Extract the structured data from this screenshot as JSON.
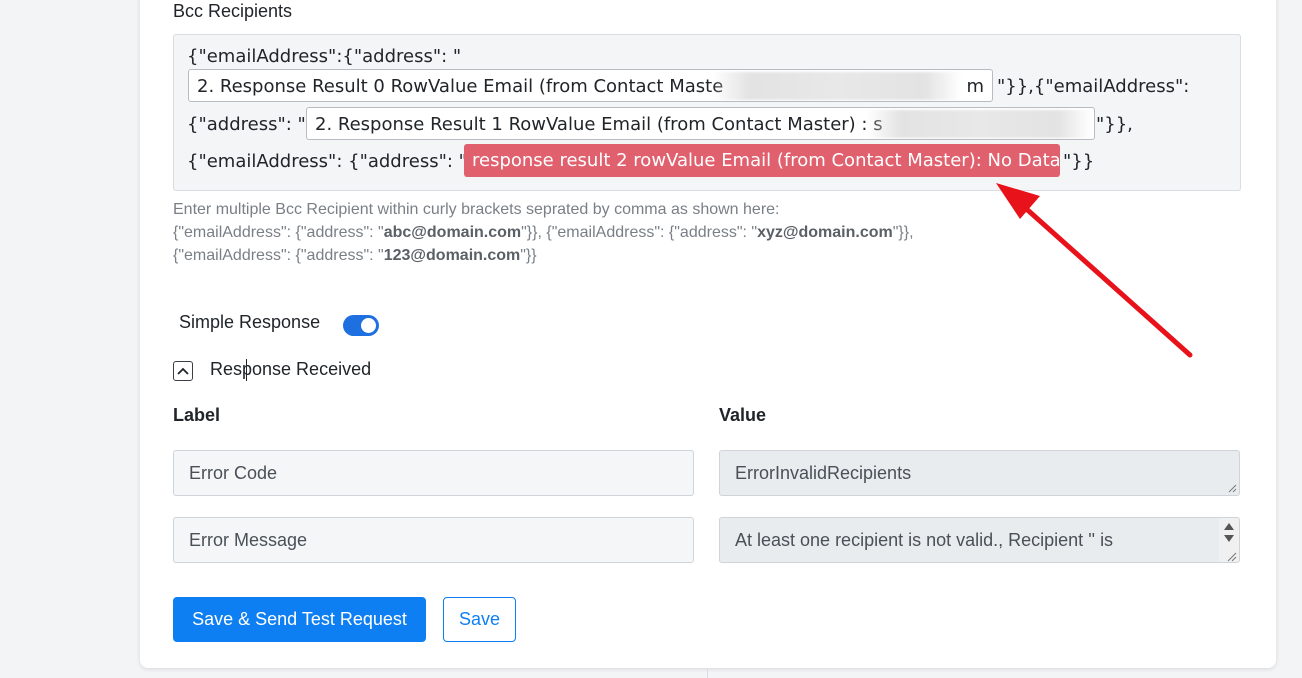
{
  "bcc": {
    "label": "Bcc Recipients",
    "line1_prefix": "{\"emailAddress\":{\"address\": \"",
    "chip0": "2. Response Result 0 RowValue Email (from Contact Maste",
    "chip0_tail": "m",
    "line1_suffix": "\"}},{\"emailAddress\":",
    "line2_prefix": "{\"address\": \"",
    "chip1": "2. Response Result 1 RowValue Email (from Contact Master) : s",
    "line2_suffix": "\"}},",
    "line3_prefix": "{\"emailAddress\": {\"address\": \"",
    "chip2_error": "response result 2 rowValue Email (from Contact Master): No Data",
    "line3_suffix": "\"}}"
  },
  "help": {
    "line1": "Enter multiple Bcc Recipient within curly brackets seprated by comma as shown here:",
    "l2a": "{\"emailAddress\": {\"address\": \"",
    "l2b": "abc@domain.com",
    "l2c": "\"}}, {\"emailAddress\": {\"address\": \"",
    "l2d": "xyz@domain.com",
    "l2e": "\"}},",
    "l3a": "{\"emailAddress\": {\"address\": \"",
    "l3b": "123@domain.com",
    "l3c": "\"}}"
  },
  "simple_response": {
    "label": "Simple Response",
    "enabled": true,
    "toggle_color": "#1e6fe0"
  },
  "response_received": {
    "label_a": "Res",
    "label_b": "ponse Received"
  },
  "table": {
    "label_header": "Label",
    "value_header": "Value",
    "rows": [
      {
        "label": "Error Code",
        "value": "ErrorInvalidRecipients"
      },
      {
        "label": "Error Message",
        "value": "At least one recipient is not valid., Recipient '' is"
      }
    ]
  },
  "buttons": {
    "save_send": "Save & Send Test Request",
    "save": "Save"
  },
  "colors": {
    "primary": "#0d7ff2",
    "error_chip": "#e0606e",
    "arrow": "#e8121b"
  }
}
